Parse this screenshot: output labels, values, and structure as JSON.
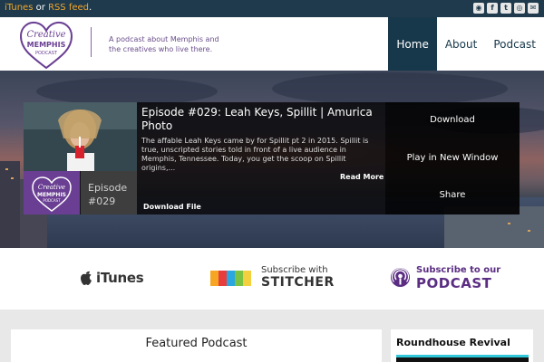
{
  "topbar": {
    "itunes_link": "iTunes",
    "or_text": " or ",
    "rss_link": "RSS feed",
    "period": ".",
    "social_icons": [
      "podcast-icon",
      "facebook-icon",
      "twitter-icon",
      "instagram-icon",
      "email-icon"
    ],
    "social_glyphs": [
      "◉",
      "f",
      "t",
      "◎",
      "✉"
    ]
  },
  "header": {
    "logo_text": [
      "Creative",
      "MEMPHIS",
      "PODCAST"
    ],
    "tagline_1": "A podcast about Memphis and",
    "tagline_2": "the creatives who live there.",
    "nav": [
      {
        "label": "Home",
        "active": true
      },
      {
        "label": "About",
        "active": false
      },
      {
        "label": "Podcast",
        "active": false
      }
    ]
  },
  "hero": {
    "episode_title": "Episode #029: Leah Keys, Spillit | Amurica Photo",
    "episode_desc": "The affable Leah Keys came by for Spillit pt 2 in 2015. Spillit is true, unscripted stories told in front of a live audience in Memphis, Tennessee. Today, you get the scoop on Spillit origins,...",
    "read_more": "Read More",
    "download_file": "Download File",
    "episode_label": "Episode",
    "episode_number": "#029",
    "actions": [
      "Download",
      "Play in New Window",
      "Share"
    ]
  },
  "subscribe": {
    "itunes_word": "iTunes",
    "stitcher_line1": "Subscribe with",
    "stitcher_line2": "STITCHER",
    "stitcher_colors": [
      "#f6a623",
      "#e83d3d",
      "#2aa7e0",
      "#7cc242",
      "#f4d03f",
      "#555555"
    ],
    "podcast_line1": "Subscribe to our",
    "podcast_line2": "PODCAST"
  },
  "bottom": {
    "featured_heading": "Featured Podcast",
    "sidebar_heading": "Roundhouse Revival"
  },
  "colors": {
    "topbar_bg": "#1e3a4c",
    "link_accent": "#f2a52a",
    "nav_active_bg": "#17384a",
    "brand_purple": "#6a3f93",
    "sidebar_accent": "#30c7d8"
  }
}
